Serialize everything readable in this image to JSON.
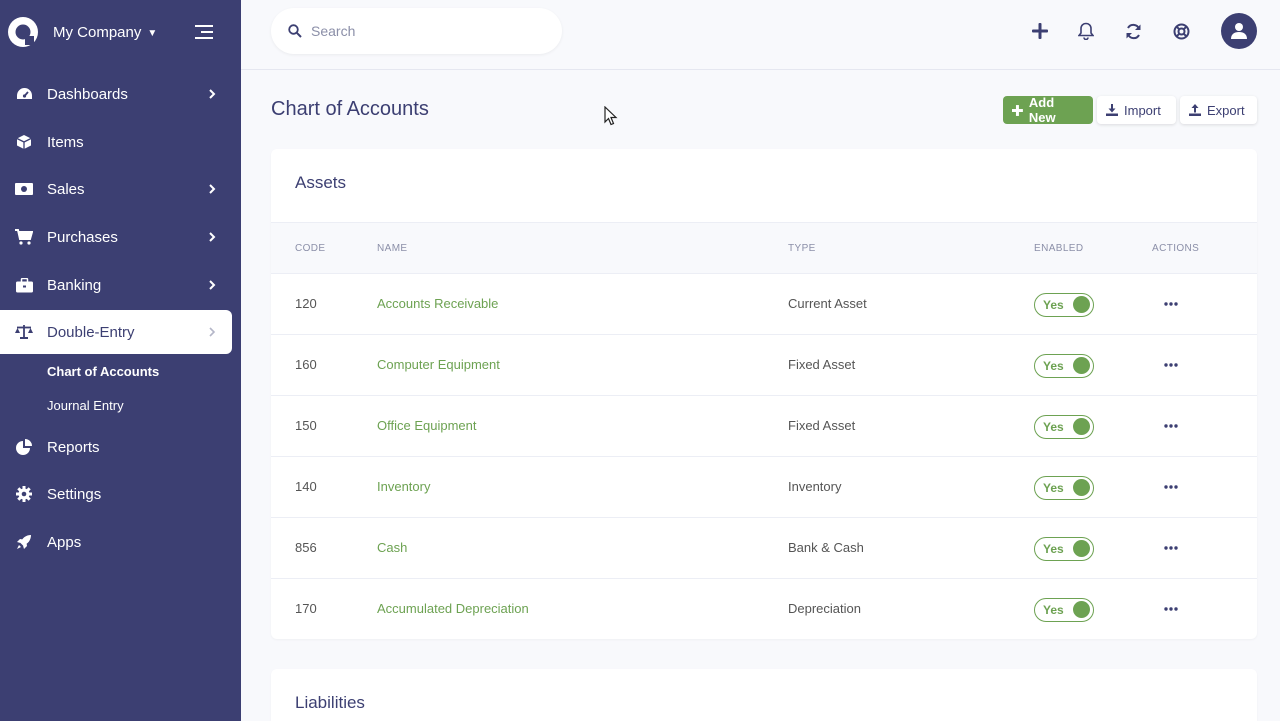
{
  "sidebar": {
    "company": "My Company",
    "items": [
      {
        "label": "Dashboards",
        "icon": "tachometer-icon",
        "chevron": true
      },
      {
        "label": "Items",
        "icon": "cube-icon",
        "chevron": false
      },
      {
        "label": "Sales",
        "icon": "money-bill-icon",
        "chevron": true
      },
      {
        "label": "Purchases",
        "icon": "shopping-cart-icon",
        "chevron": true
      },
      {
        "label": "Banking",
        "icon": "briefcase-icon",
        "chevron": true
      },
      {
        "label": "Double-Entry",
        "icon": "balance-scale-icon",
        "chevron": true,
        "active": true
      },
      {
        "label": "Reports",
        "icon": "pie-chart-icon",
        "chevron": false
      },
      {
        "label": "Settings",
        "icon": "gear-icon",
        "chevron": false
      },
      {
        "label": "Apps",
        "icon": "rocket-icon",
        "chevron": false
      }
    ],
    "subitems": [
      {
        "label": "Chart of Accounts",
        "active": true
      },
      {
        "label": "Journal Entry",
        "active": false
      }
    ]
  },
  "header": {
    "search_placeholder": "Search"
  },
  "page": {
    "title": "Chart of Accounts",
    "add_new": "Add New",
    "import": "Import",
    "export": "Export"
  },
  "table": {
    "columns": [
      "CODE",
      "NAME",
      "TYPE",
      "ENABLED",
      "ACTIONS"
    ]
  },
  "sections": [
    {
      "title": "Assets",
      "rows": [
        {
          "code": "120",
          "name": "Accounts Receivable",
          "type": "Current Asset",
          "enabled": "Yes"
        },
        {
          "code": "160",
          "name": "Computer Equipment",
          "type": "Fixed Asset",
          "enabled": "Yes"
        },
        {
          "code": "150",
          "name": "Office Equipment",
          "type": "Fixed Asset",
          "enabled": "Yes"
        },
        {
          "code": "140",
          "name": "Inventory",
          "type": "Inventory",
          "enabled": "Yes"
        },
        {
          "code": "856",
          "name": "Cash",
          "type": "Bank & Cash",
          "enabled": "Yes"
        },
        {
          "code": "170",
          "name": "Accumulated Depreciation",
          "type": "Depreciation",
          "enabled": "Yes"
        }
      ]
    },
    {
      "title": "Liabilities",
      "rows": []
    }
  ],
  "colors": {
    "sidebar": "#3c3f72",
    "accent_green": "#6da252",
    "page_bg": "#f8f9fc"
  }
}
